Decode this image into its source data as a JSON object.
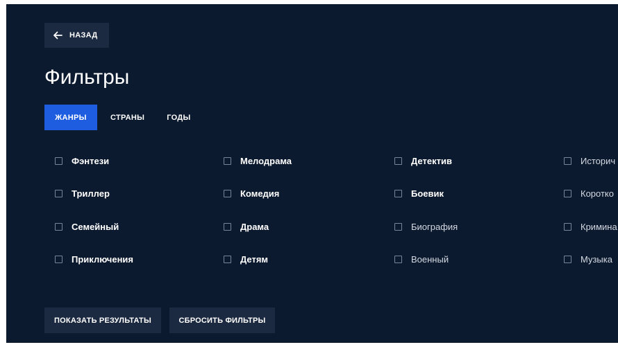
{
  "header": {
    "back_label": "НАЗАД",
    "title": "Фильтры"
  },
  "tabs": [
    {
      "label": "ЖАНРЫ",
      "active": true
    },
    {
      "label": "СТРАНЫ",
      "active": false
    },
    {
      "label": "ГОДЫ",
      "active": false
    }
  ],
  "genres": {
    "col1": [
      "Фэнтези",
      "Триллер",
      "Семейный",
      "Приключения"
    ],
    "col2": [
      "Мелодрама",
      "Комедия",
      "Драма",
      "Детям"
    ],
    "col3": [
      "Детектив",
      "Боевик",
      "Биография",
      "Военный"
    ],
    "col4": [
      "Историч",
      "Коротко",
      "Кримина",
      "Музыка"
    ]
  },
  "actions": {
    "show_results": "ПОКАЗАТЬ РЕЗУЛЬТАТЫ",
    "reset_filters": "СБРОСИТЬ ФИЛЬТРЫ"
  },
  "colors": {
    "background": "#0c1a30",
    "button_bg": "#1c2a41",
    "accent": "#1f5de0"
  }
}
